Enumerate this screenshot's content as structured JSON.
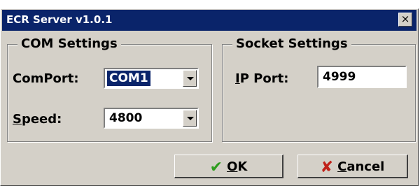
{
  "window": {
    "title": "ECR Server v1.0.1",
    "close_glyph": "×"
  },
  "com_settings": {
    "legend": "COM Settings",
    "comport_label_prefix": "",
    "comport_label": "ComPort:",
    "comport_value": "COM1",
    "speed_label_hotkey": "S",
    "speed_label_rest": "peed:",
    "speed_value": "4800"
  },
  "socket_settings": {
    "legend": "Socket Settings",
    "ipport_label_hotkey": "I",
    "ipport_label_rest": "P Port:",
    "ipport_value": "4999"
  },
  "buttons": {
    "ok_hotkey": "O",
    "ok_rest": "K",
    "cancel_hotkey": "C",
    "cancel_rest": "ancel",
    "ok_icon": "check-icon",
    "cancel_icon": "cross-icon"
  },
  "colors": {
    "titlebar": "#0a246a",
    "face": "#d4d0c8",
    "ok_icon": "#2e9d1e",
    "cancel_icon": "#c0221a"
  }
}
